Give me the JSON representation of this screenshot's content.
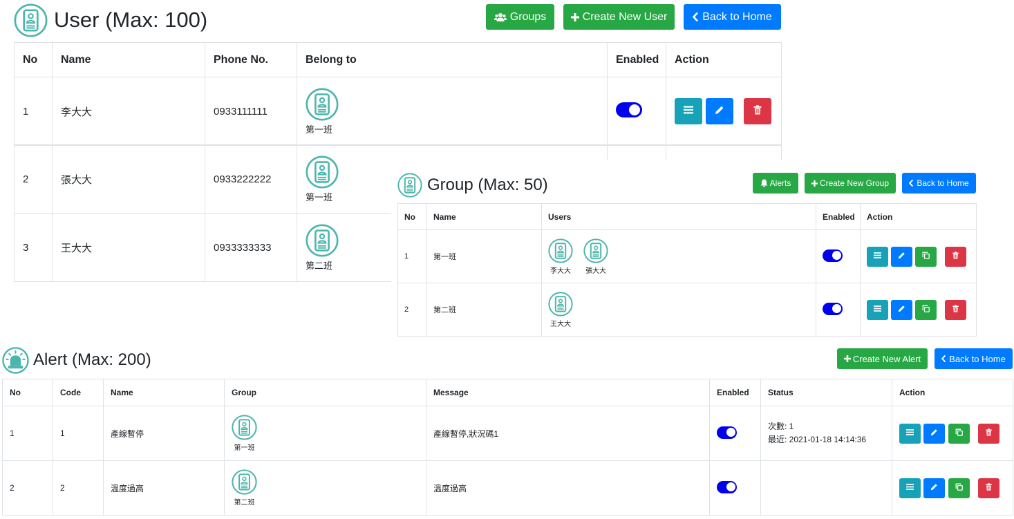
{
  "colors": {
    "green": "#28a745",
    "blue": "#007bff",
    "teal": "#17a2b8",
    "red": "#dc3545",
    "toggle": "#0000ee",
    "icon": "#4db6ac"
  },
  "user": {
    "title": "User (Max: 100)",
    "buttons": {
      "groups": "Groups",
      "create": "Create New User",
      "back": "Back to Home"
    },
    "headers": [
      "No",
      "Name",
      "Phone No.",
      "Belong to",
      "Enabled",
      "Action"
    ],
    "rows": [
      {
        "no": "1",
        "name": "李大大",
        "phone": "0933111111",
        "group": "第一班",
        "enabled": true
      },
      {
        "no": "2",
        "name": "張大大",
        "phone": "0933222222",
        "group": "第一班",
        "enabled": true
      },
      {
        "no": "3",
        "name": "王大大",
        "phone": "0933333333",
        "group": "第二班",
        "enabled": true
      }
    ]
  },
  "group": {
    "title": "Group (Max: 50)",
    "buttons": {
      "alerts": "Alerts",
      "create": "Create New Group",
      "back": "Back to Home"
    },
    "headers": [
      "No",
      "Name",
      "Users",
      "Enabled",
      "Action"
    ],
    "rows": [
      {
        "no": "1",
        "name": "第一班",
        "users": [
          "李大大",
          "張大大"
        ],
        "enabled": true
      },
      {
        "no": "2",
        "name": "第二班",
        "users": [
          "王大大"
        ],
        "enabled": true
      }
    ]
  },
  "alert": {
    "title": "Alert (Max: 200)",
    "buttons": {
      "create": "Create New Alert",
      "back": "Back to Home"
    },
    "headers": [
      "No",
      "Code",
      "Name",
      "Group",
      "Message",
      "Enabled",
      "Status",
      "Action"
    ],
    "rows": [
      {
        "no": "1",
        "code": "1",
        "name": "產線暫停",
        "group": "第一班",
        "message": "產線暫停,狀況碼1",
        "enabled": true,
        "status": [
          "次數: 1",
          "最近: 2021-01-18 14:14:36"
        ]
      },
      {
        "no": "2",
        "code": "2",
        "name": "溫度過高",
        "group": "第二班",
        "message": "溫度過高",
        "enabled": true,
        "status": []
      }
    ]
  }
}
